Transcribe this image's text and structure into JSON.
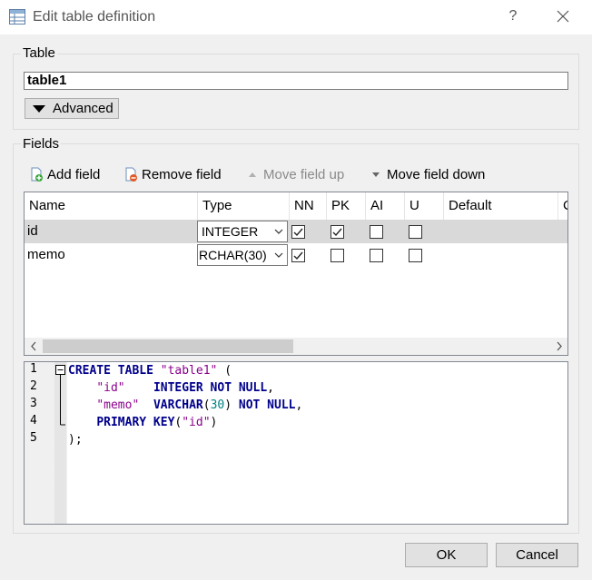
{
  "window": {
    "title": "Edit table definition",
    "help_label": "?"
  },
  "table_group": {
    "label": "Table",
    "name_value": "table1",
    "advanced_label": "Advanced"
  },
  "fields_group": {
    "label": "Fields",
    "toolbar": {
      "add": "Add field",
      "remove": "Remove field",
      "up": "Move field up",
      "down": "Move field down"
    },
    "columns": [
      "Name",
      "Type",
      "NN",
      "PK",
      "AI",
      "U",
      "Default",
      "C"
    ],
    "rows": [
      {
        "name": "id",
        "type": "INTEGER",
        "nn": true,
        "pk": true,
        "ai": false,
        "u": false
      },
      {
        "name": "memo",
        "type": "RCHAR(30)",
        "nn": true,
        "pk": false,
        "ai": false,
        "u": false
      }
    ]
  },
  "sql": {
    "line_numbers": [
      "1",
      "2",
      "3",
      "4",
      "5"
    ],
    "l1": {
      "kw1": "CREATE TABLE",
      "str": "\"table1\"",
      "p": " ("
    },
    "l2": {
      "str": "\"id\"",
      "kw": "INTEGER NOT NULL",
      "p": ","
    },
    "l3": {
      "str": "\"memo\"",
      "kw1": "VARCHAR",
      "p1": "(",
      "num": "30",
      "p2": ")",
      "kw2": "NOT NULL",
      "p3": ","
    },
    "l4": {
      "kw": "PRIMARY KEY",
      "p1": "(",
      "str": "\"id\"",
      "p2": ")"
    },
    "l5": {
      "p": ");"
    }
  },
  "buttons": {
    "ok": "OK",
    "cancel": "Cancel"
  }
}
